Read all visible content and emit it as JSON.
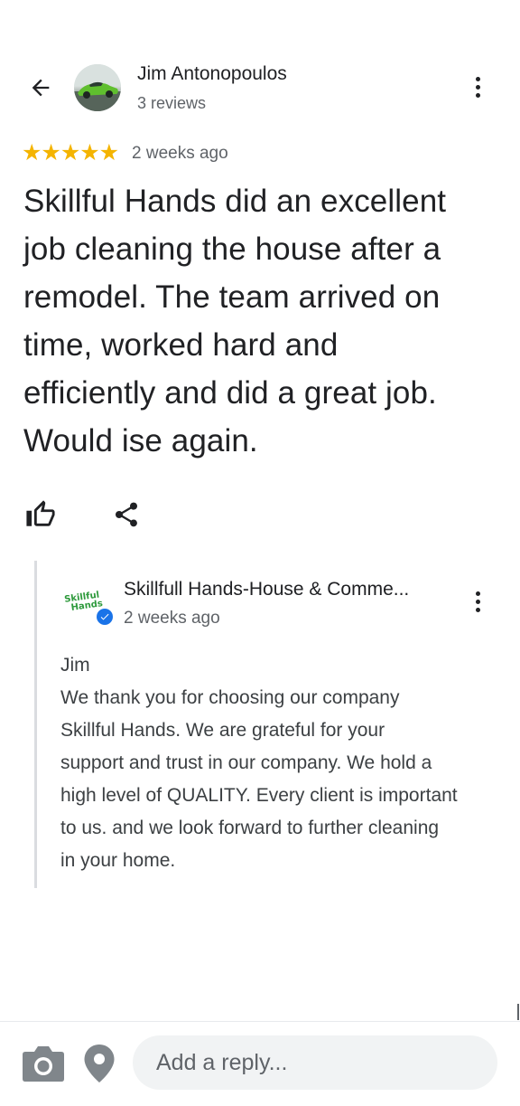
{
  "header": {
    "author_name": "Jim Antonopoulos",
    "author_reviews": "3 reviews"
  },
  "review": {
    "rating": 5,
    "stars_text": "★★★★★",
    "date": "2 weeks ago",
    "text": "Skillful Hands did an excellent job cleaning the house after a remodel. The team arrived on time, worked hard and efficiently and did a great job. Would ise again.",
    "lines": [
      "Skillful Hands did an excellent",
      "job cleaning the house after a",
      "remodel. The team arrived on",
      "time, worked hard and",
      "efficiently and did a great job.",
      "Would ise again."
    ]
  },
  "owner_reply": {
    "logo_line1": "Skillful",
    "logo_line2": "Hands",
    "name": "Skillfull Hands-House & Comme...",
    "date": "2 weeks ago",
    "lines": [
      "Jim",
      "We thank you for choosing our company",
      "Skillful Hands.  We are grateful for your",
      "support and trust in our company.  We hold a",
      "high level of QUALITY.  Every client is important",
      "to us.  and we look forward to further cleaning",
      "in your home."
    ]
  },
  "reply_bar": {
    "placeholder": "Add a reply...",
    "value": ""
  },
  "icons": {
    "back": "arrow-back-icon",
    "more": "more-vert-icon",
    "like": "thumb-up-icon",
    "share": "share-icon",
    "verified": "verified-check-icon",
    "camera": "camera-icon",
    "location": "location-pin-icon"
  },
  "colors": {
    "star": "#f4b400",
    "verified": "#1a73e8",
    "logo_green": "#2e9a3c",
    "input_bg": "#f1f3f4",
    "secondary_text": "#5f6368"
  }
}
